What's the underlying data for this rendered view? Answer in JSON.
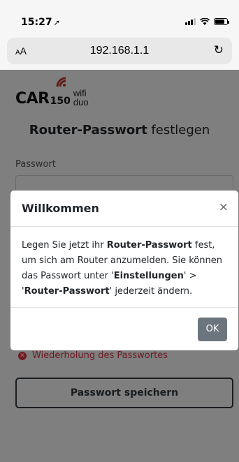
{
  "statusbar": {
    "time": "15:27",
    "location_icon": "location-arrow-icon"
  },
  "browser": {
    "aa_label_small": "A",
    "aa_label_large": "A",
    "url": "192.168.1.1",
    "reload_icon": "reload-icon"
  },
  "logo": {
    "car": "CAR",
    "number": "150",
    "wifi": "wifi",
    "duo": "duo"
  },
  "page": {
    "title_bold": "Router-Passwort",
    "title_rest": " festlegen",
    "password_label": "Passwort",
    "error_prefix": "Wiederholung des ",
    "error_bold": "Passwortes",
    "save_button": "Passwort speichern"
  },
  "modal": {
    "title": "Willkommen",
    "close": "×",
    "body": {
      "t1": "Legen Sie jetzt ihr ",
      "b1": "Router-Passwort",
      "t2": " fest, um sich am Router anzumelden. Sie können das Passwort unter '",
      "b2": "Einstellungen",
      "t3": "' > '",
      "b3": "Router-Passwort",
      "t4": "' jederzeit ändern."
    },
    "ok_button": "OK"
  },
  "colors": {
    "error": "#dc3545",
    "ok_button": "#6c757d",
    "overlay": "rgba(0,0,0,0.5)"
  }
}
